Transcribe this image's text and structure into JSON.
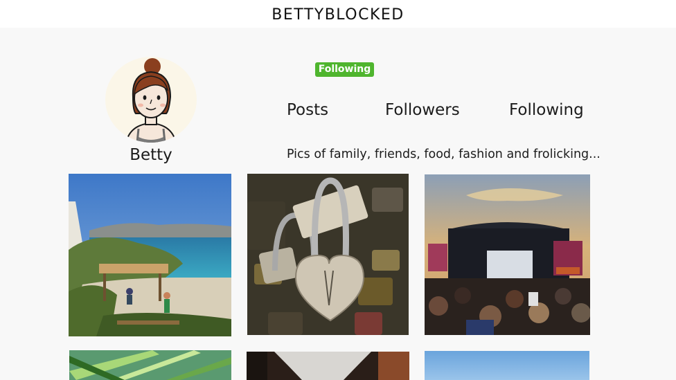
{
  "header": {
    "title": "BETTYBLOCKED"
  },
  "profile": {
    "name": "Betty",
    "follow_status": "Following",
    "bio": "Pics of family, friends, food, fashion and frolicking..."
  },
  "stats": {
    "posts_label": "Posts",
    "followers_label": "Followers",
    "following_label": "Following"
  },
  "colors": {
    "follow_badge": "#4fb52e",
    "header_bg": "#ffffff",
    "page_bg": "#f8f8f8"
  },
  "grid": {
    "photos": [
      {
        "name": "beach-photo"
      },
      {
        "name": "love-locks-photo"
      },
      {
        "name": "concert-photo"
      },
      {
        "name": "palm-leaves-photo"
      },
      {
        "name": "cup-photo"
      },
      {
        "name": "sky-photo"
      }
    ]
  }
}
